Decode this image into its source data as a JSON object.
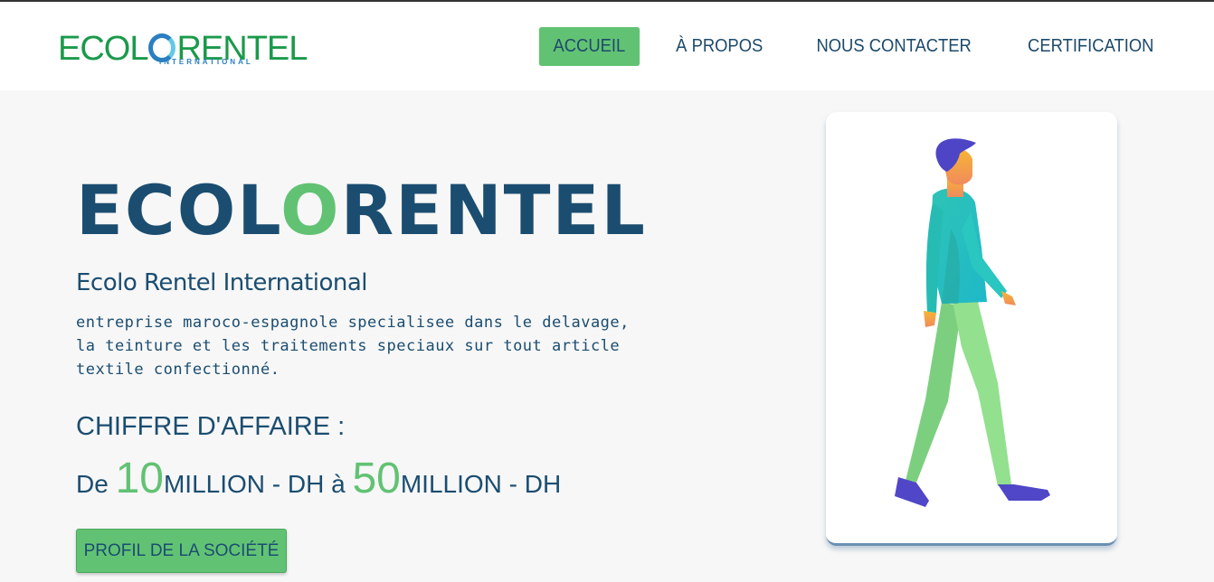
{
  "header": {
    "logo_main": "ECOL",
    "logo_rest": "RENTEL",
    "logo_sub": "INTERNATIONAL",
    "nav": [
      {
        "label": "ACCUEIL",
        "active": true
      },
      {
        "label": "À PROPOS",
        "active": false
      },
      {
        "label": "NOUS CONTACTER",
        "active": false
      },
      {
        "label": "CERTIFICATION",
        "active": false
      }
    ]
  },
  "hero": {
    "title_part1": "ECOL",
    "title_accent": "O",
    "title_part2": "RENTEL",
    "subtitle": "Ecolo Rentel International",
    "description": "entreprise maroco-espagnole specialisee dans le delavage, la teinture et les traitements speciaux sur tout article textile confectionné.",
    "revenue_title": "CHIFFRE D'AFFAIRE :",
    "revenue_prefix": "De ",
    "revenue_low": "10",
    "revenue_mid": "MILLION - DH à ",
    "revenue_high": "50",
    "revenue_suffix": "MILLION - DH",
    "cta_label": "PROFIL DE LA SOCIÉTÉ"
  },
  "colors": {
    "primary": "#1b4d70",
    "accent": "#62c274",
    "background": "#f7f7f7"
  },
  "illustration": "walking-man-illustration"
}
